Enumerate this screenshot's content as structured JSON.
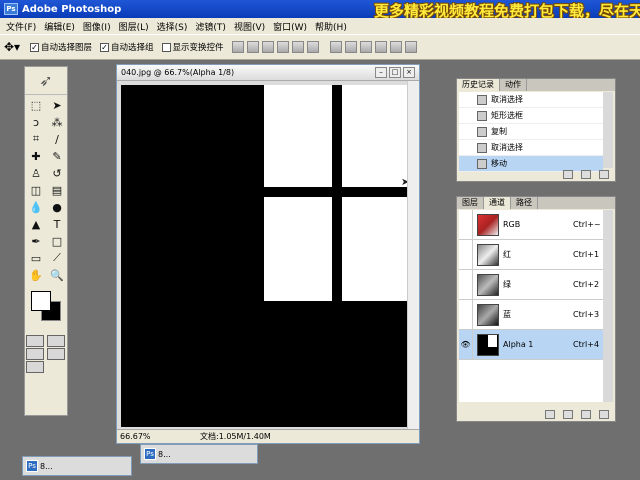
{
  "titlebar": {
    "title": "Adobe Photoshop",
    "promo": "更多精彩视频教程免费打包下载，尽在天"
  },
  "menu": {
    "items": [
      "文件(F)",
      "编辑(E)",
      "图像(I)",
      "图层(L)",
      "选择(S)",
      "滤镜(T)",
      "视图(V)",
      "窗口(W)",
      "帮助(H)"
    ]
  },
  "options": {
    "auto_select_layer": "自动选择图层",
    "auto_select_group": "自动选择组",
    "show_transform": "显示变换控件"
  },
  "document": {
    "title": "040.jpg @ 66.7%(Alpha 1/8)",
    "zoom": "66.67%",
    "doc_info": "文档:1.05M/1.40M"
  },
  "history": {
    "tabs": [
      "历史记录",
      "动作"
    ],
    "items": [
      "取消选择",
      "矩形选框",
      "复制",
      "取消选择",
      "移动"
    ]
  },
  "channels": {
    "tabs": [
      "图层",
      "通道",
      "路径"
    ],
    "items": [
      {
        "name": "RGB",
        "key": "Ctrl+~"
      },
      {
        "name": "红",
        "key": "Ctrl+1"
      },
      {
        "name": "绿",
        "key": "Ctrl+2"
      },
      {
        "name": "蓝",
        "key": "Ctrl+3"
      },
      {
        "name": "Alpha 1",
        "key": "Ctrl+4"
      }
    ]
  },
  "minimized": [
    "8...",
    "8..."
  ],
  "colors": {
    "selection": "#b8d6f4",
    "titlebar": "#0a3cb8",
    "promo_text": "#ffeb3b"
  }
}
